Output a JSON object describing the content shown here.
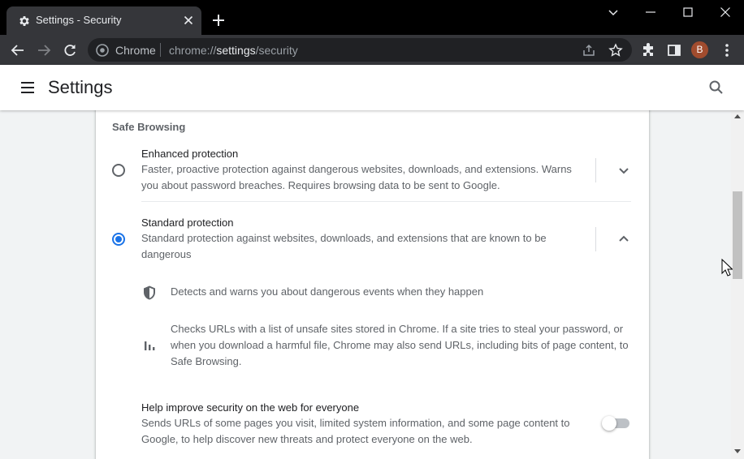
{
  "tab": {
    "title": "Settings - Security"
  },
  "omnibox": {
    "site": "Chrome",
    "url_prefix": "chrome://",
    "url_host": "settings",
    "url_path": "/security"
  },
  "profile": {
    "initial": "B"
  },
  "header": {
    "title": "Settings"
  },
  "safe_browsing": {
    "section_title": "Safe Browsing",
    "options": [
      {
        "label": "Enhanced protection",
        "description": "Faster, proactive protection against dangerous websites, downloads, and extensions. Warns you about password breaches. Requires browsing data to be sent to Google.",
        "selected": false,
        "expanded": false
      },
      {
        "label": "Standard protection",
        "description": "Standard protection against websites, downloads, and extensions that are known to be dangerous",
        "selected": true,
        "expanded": true
      }
    ],
    "details": [
      {
        "icon": "shield-icon",
        "text": "Detects and warns you about dangerous events when they happen"
      },
      {
        "icon": "bar-chart-icon",
        "text": "Checks URLs with a list of unsafe sites stored in Chrome. If a site tries to steal your password, or when you download a harmful file, Chrome may also send URLs, including bits of page content, to Safe Browsing."
      }
    ],
    "help_improve": {
      "label": "Help improve security on the web for everyone",
      "description": "Sends URLs of some pages you visit, limited system information, and some page content to Google, to help discover new threats and protect everyone on the web.",
      "enabled": false
    }
  },
  "colors": {
    "accent": "#1a73e8",
    "frame": "#000000",
    "toolbar": "#35363a"
  }
}
